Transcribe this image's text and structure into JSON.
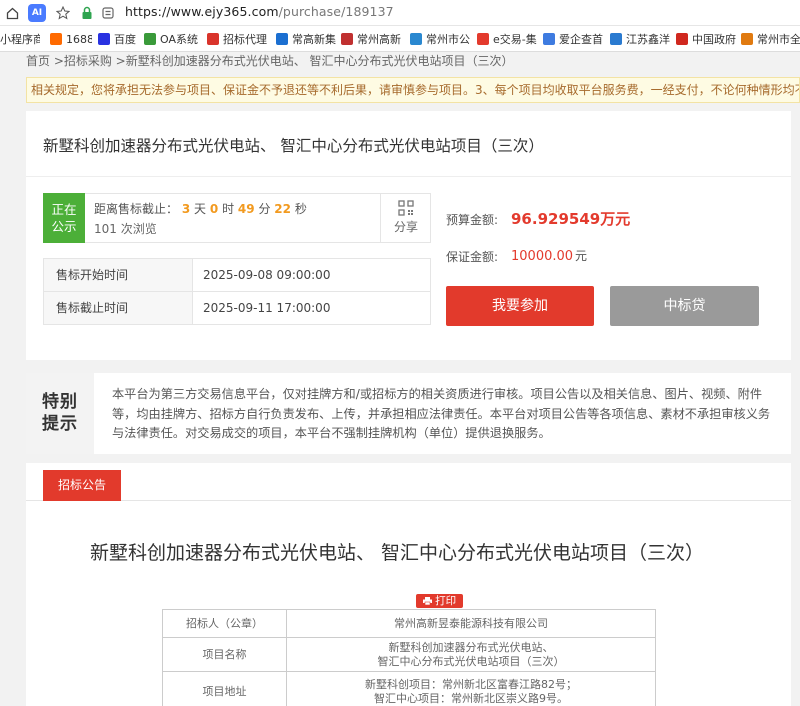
{
  "browser": {
    "url_host": "https://www.ejy365.com",
    "url_path": "/purchase/189137",
    "bookmarks": [
      {
        "label": "小程序商",
        "color": "#7a7a7a"
      },
      {
        "label": "1688",
        "color": "#ff6a00"
      },
      {
        "label": "百度",
        "color": "#2932e1"
      },
      {
        "label": "OA系统",
        "color": "#3a9a3a"
      },
      {
        "label": "招标代理",
        "color": "#d9342b"
      },
      {
        "label": "常高新集",
        "color": "#1b6fd1"
      },
      {
        "label": "常州高新",
        "color": "#c03030"
      },
      {
        "label": "常州市公",
        "color": "#2a88d0"
      },
      {
        "label": "e交易-集",
        "color": "#e33a2d"
      },
      {
        "label": "爱企查首",
        "color": "#3e7be0"
      },
      {
        "label": "江苏鑫洋",
        "color": "#2a7ad0"
      },
      {
        "label": "中国政府",
        "color": "#d0281f"
      },
      {
        "label": "常州市全",
        "color": "#e07a10"
      }
    ]
  },
  "breadcrumb": "首页 >招标采购 >新墅科创加速器分布式光伏电站、 智汇中心分布式光伏电站项目（三次）",
  "notice": "相关规定，您将承担无法参与项目、保证金不予退还等不利后果，请审慎参与项目。3、每个项目均收取平台服务费，一经支付，不论何种情形均不予退还",
  "project": {
    "title": "新墅科创加速器分布式光伏电站、 智汇中心分布式光伏电站项目（三次）",
    "status": "正在公示",
    "countdown_prefix": "距离售标截止：",
    "days": "3",
    "days_unit": "天",
    "hours": "0",
    "hours_unit": "时",
    "minutes": "49",
    "minutes_unit": "分",
    "seconds": "22",
    "seconds_unit": "秒",
    "views": "101 次浏览",
    "share_label": "分享",
    "start_label": "售标开始时间",
    "start_value": "2025-09-08 09:00:00",
    "end_label": "售标截止时间",
    "end_value": "2025-09-11 17:00:00",
    "budget_label": "预算金额:",
    "budget_value": "96.929549万元",
    "deposit_label": "保证金额:",
    "deposit_value": "10000.00",
    "deposit_unit": "元",
    "join_button": "我要参加",
    "loan_button": "中标贷"
  },
  "special": {
    "heading": "特别提示",
    "text": "本平台为第三方交易信息平台，仅对挂牌方和/或招标方的相关资质进行审核。项目公告以及相关信息、图片、视频、附件等，均由挂牌方、招标方自行负责发布、上传，并承担相应法律责任。本平台对项目公告等各项信息、素材不承担审核义务与法律责任。对交易成交的项目，本平台不强制挂牌机构（单位）提供退换服务。"
  },
  "announcement": {
    "tab": "招标公告",
    "title": "新墅科创加速器分布式光伏电站、 智汇中心分布式光伏电站项目（三次）",
    "print": "打印",
    "rows": [
      {
        "key": "招标人（公章）",
        "line1": "常州高新昱泰能源科技有限公司",
        "line2": ""
      },
      {
        "key": "项目名称",
        "line1": "新墅科创加速器分布式光伏电站、",
        "line2": "智汇中心分布式光伏电站项目（三次）"
      },
      {
        "key": "项目地址",
        "line1": "新墅科创项目：常州新北区富春江路82号；",
        "line2": "智汇中心项目：常州新北区崇义路9号。"
      }
    ]
  }
}
